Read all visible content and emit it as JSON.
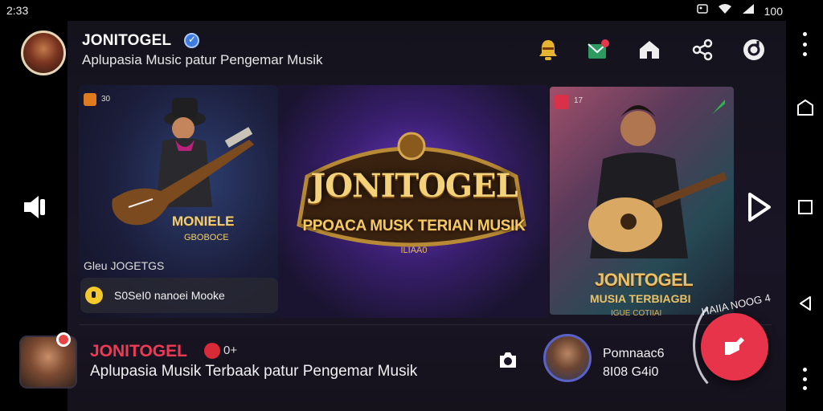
{
  "status_bar": {
    "time": "2:33",
    "battery": "100"
  },
  "header": {
    "title": "JONITOGEL",
    "subtitle": "Aplupasia Music patur Pengemar Musik"
  },
  "header_icons": [
    "bell-icon",
    "mail-icon",
    "home-icon",
    "share-icon",
    "refresh-icon"
  ],
  "banner": {
    "main_logo": "JONITOGEL",
    "main_tagline": "PPOACA MUSK TERIAN MUSIK",
    "main_small": "ILIAA0",
    "left_card_label": "MONIELE",
    "left_card_sublabel": "GBOBOCE",
    "left_badge_text": "30",
    "gen_label": "Gleu JOGETGS",
    "pill_text": "S0SeI0 nanoei Mooke",
    "right_badge_text": "17",
    "right_card_title": "JONITOGEL",
    "right_card_sub": "MUSIA TERBIAGBI",
    "right_card_small": "IGUE COTIIAI"
  },
  "bottom": {
    "title": "JONITOGEL",
    "extra": "0+",
    "subtitle": "Aplupasia Musik Terbaak patur Pengemar Musik",
    "mini_name": "Pomnaac6",
    "mini_count": "8I08 G4i0",
    "fab_ring_text": "HAIIA NOOG 4"
  },
  "colors": {
    "accent_red": "#e8344a",
    "gold": "#f4d27a",
    "verified_blue": "#3f7ce0"
  }
}
